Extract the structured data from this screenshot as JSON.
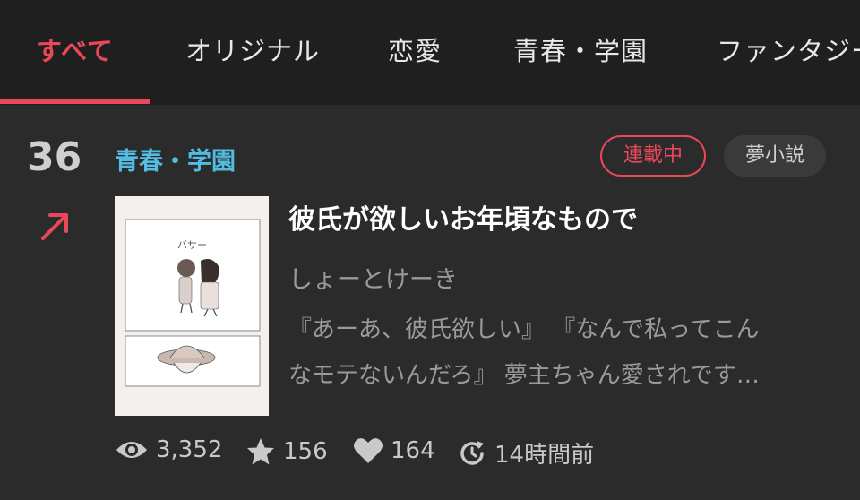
{
  "tabs": [
    {
      "label": "すべて",
      "active": true
    },
    {
      "label": "オリジナル",
      "active": false
    },
    {
      "label": "恋愛",
      "active": false
    },
    {
      "label": "青春・学園",
      "active": false
    },
    {
      "label": "ファンタジー",
      "active": false
    }
  ],
  "item": {
    "rank": "36",
    "rank_trend_icon": "arrow-up-right-icon",
    "genre": "青春・学園",
    "status_badge": "連載中",
    "type_badge": "夢小説",
    "title": "彼氏が欲しいお年頃なもので",
    "author": "しょーとけーき",
    "description_line1": "『あーあ、彼氏欲しい』 『なんで私ってこん",
    "description_line2": "なモテないんだろ』 夢主ちゃん愛されです…",
    "thumbnail_text": "バサー",
    "stats": {
      "views": "3,352",
      "stars": "156",
      "likes": "164",
      "updated": "14時間前"
    }
  },
  "colors": {
    "accent": "#e8485a",
    "genre": "#52bde0",
    "background": "#2b2b2b",
    "tabbar": "#1f1f1f"
  }
}
